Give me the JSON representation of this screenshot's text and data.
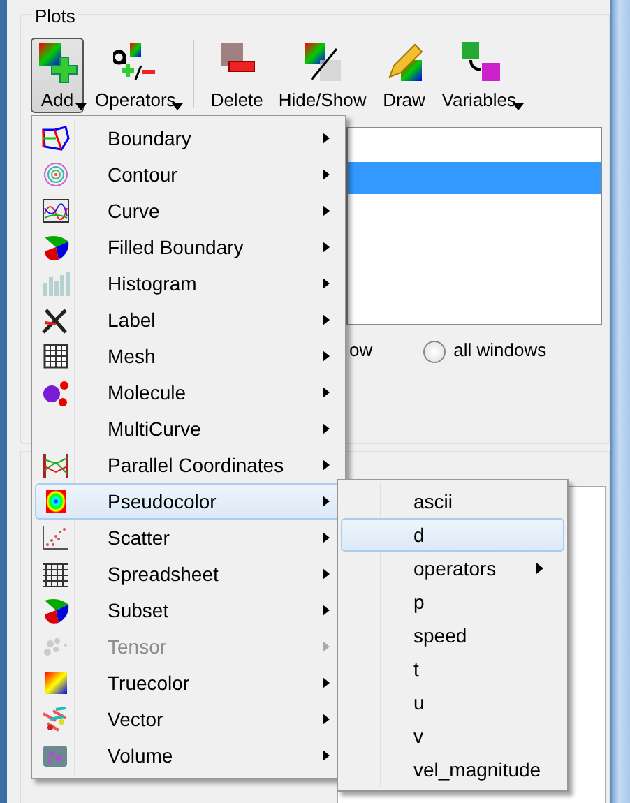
{
  "plots_group": {
    "title": "Plots"
  },
  "toolbar": [
    {
      "label": "Add",
      "pressed": true,
      "dropdown": true
    },
    {
      "label": "Operators",
      "pressed": false,
      "dropdown": true
    },
    {
      "label": "Delete",
      "pressed": false,
      "dropdown": false
    },
    {
      "label": "Hide/Show",
      "pressed": false,
      "dropdown": false
    },
    {
      "label": "Draw",
      "pressed": false,
      "dropdown": false
    },
    {
      "label": "Variables",
      "pressed": false,
      "dropdown": true
    }
  ],
  "plot_list": {
    "rows": [
      {
        "selected": true
      }
    ]
  },
  "apply_to": {
    "partial_label": "ow",
    "radio": {
      "label": "all windows",
      "checked": false
    }
  },
  "add_menu": [
    {
      "label": "Boundary",
      "selected": false,
      "disabled": false
    },
    {
      "label": "Contour",
      "selected": false,
      "disabled": false
    },
    {
      "label": "Curve",
      "selected": false,
      "disabled": false
    },
    {
      "label": "Filled Boundary",
      "selected": false,
      "disabled": false
    },
    {
      "label": "Histogram",
      "selected": false,
      "disabled": false
    },
    {
      "label": "Label",
      "selected": false,
      "disabled": false
    },
    {
      "label": "Mesh",
      "selected": false,
      "disabled": false
    },
    {
      "label": "Molecule",
      "selected": false,
      "disabled": false
    },
    {
      "label": "MultiCurve",
      "selected": false,
      "disabled": false
    },
    {
      "label": "Parallel Coordinates",
      "selected": false,
      "disabled": false
    },
    {
      "label": "Pseudocolor",
      "selected": true,
      "disabled": false
    },
    {
      "label": "Scatter",
      "selected": false,
      "disabled": false
    },
    {
      "label": "Spreadsheet",
      "selected": false,
      "disabled": false
    },
    {
      "label": "Subset",
      "selected": false,
      "disabled": false
    },
    {
      "label": "Tensor",
      "selected": false,
      "disabled": true
    },
    {
      "label": "Truecolor",
      "selected": false,
      "disabled": false
    },
    {
      "label": "Vector",
      "selected": false,
      "disabled": false
    },
    {
      "label": "Volume",
      "selected": false,
      "disabled": false
    }
  ],
  "variable_menu": [
    {
      "label": "ascii",
      "selected": false,
      "submenu": false
    },
    {
      "label": "d",
      "selected": true,
      "submenu": false
    },
    {
      "label": "operators",
      "selected": false,
      "submenu": true
    },
    {
      "label": "p",
      "selected": false,
      "submenu": false
    },
    {
      "label": "speed",
      "selected": false,
      "submenu": false
    },
    {
      "label": "t",
      "selected": false,
      "submenu": false
    },
    {
      "label": "u",
      "selected": false,
      "submenu": false
    },
    {
      "label": "v",
      "selected": false,
      "submenu": false
    },
    {
      "label": "vel_magnitude",
      "selected": false,
      "submenu": false
    }
  ]
}
